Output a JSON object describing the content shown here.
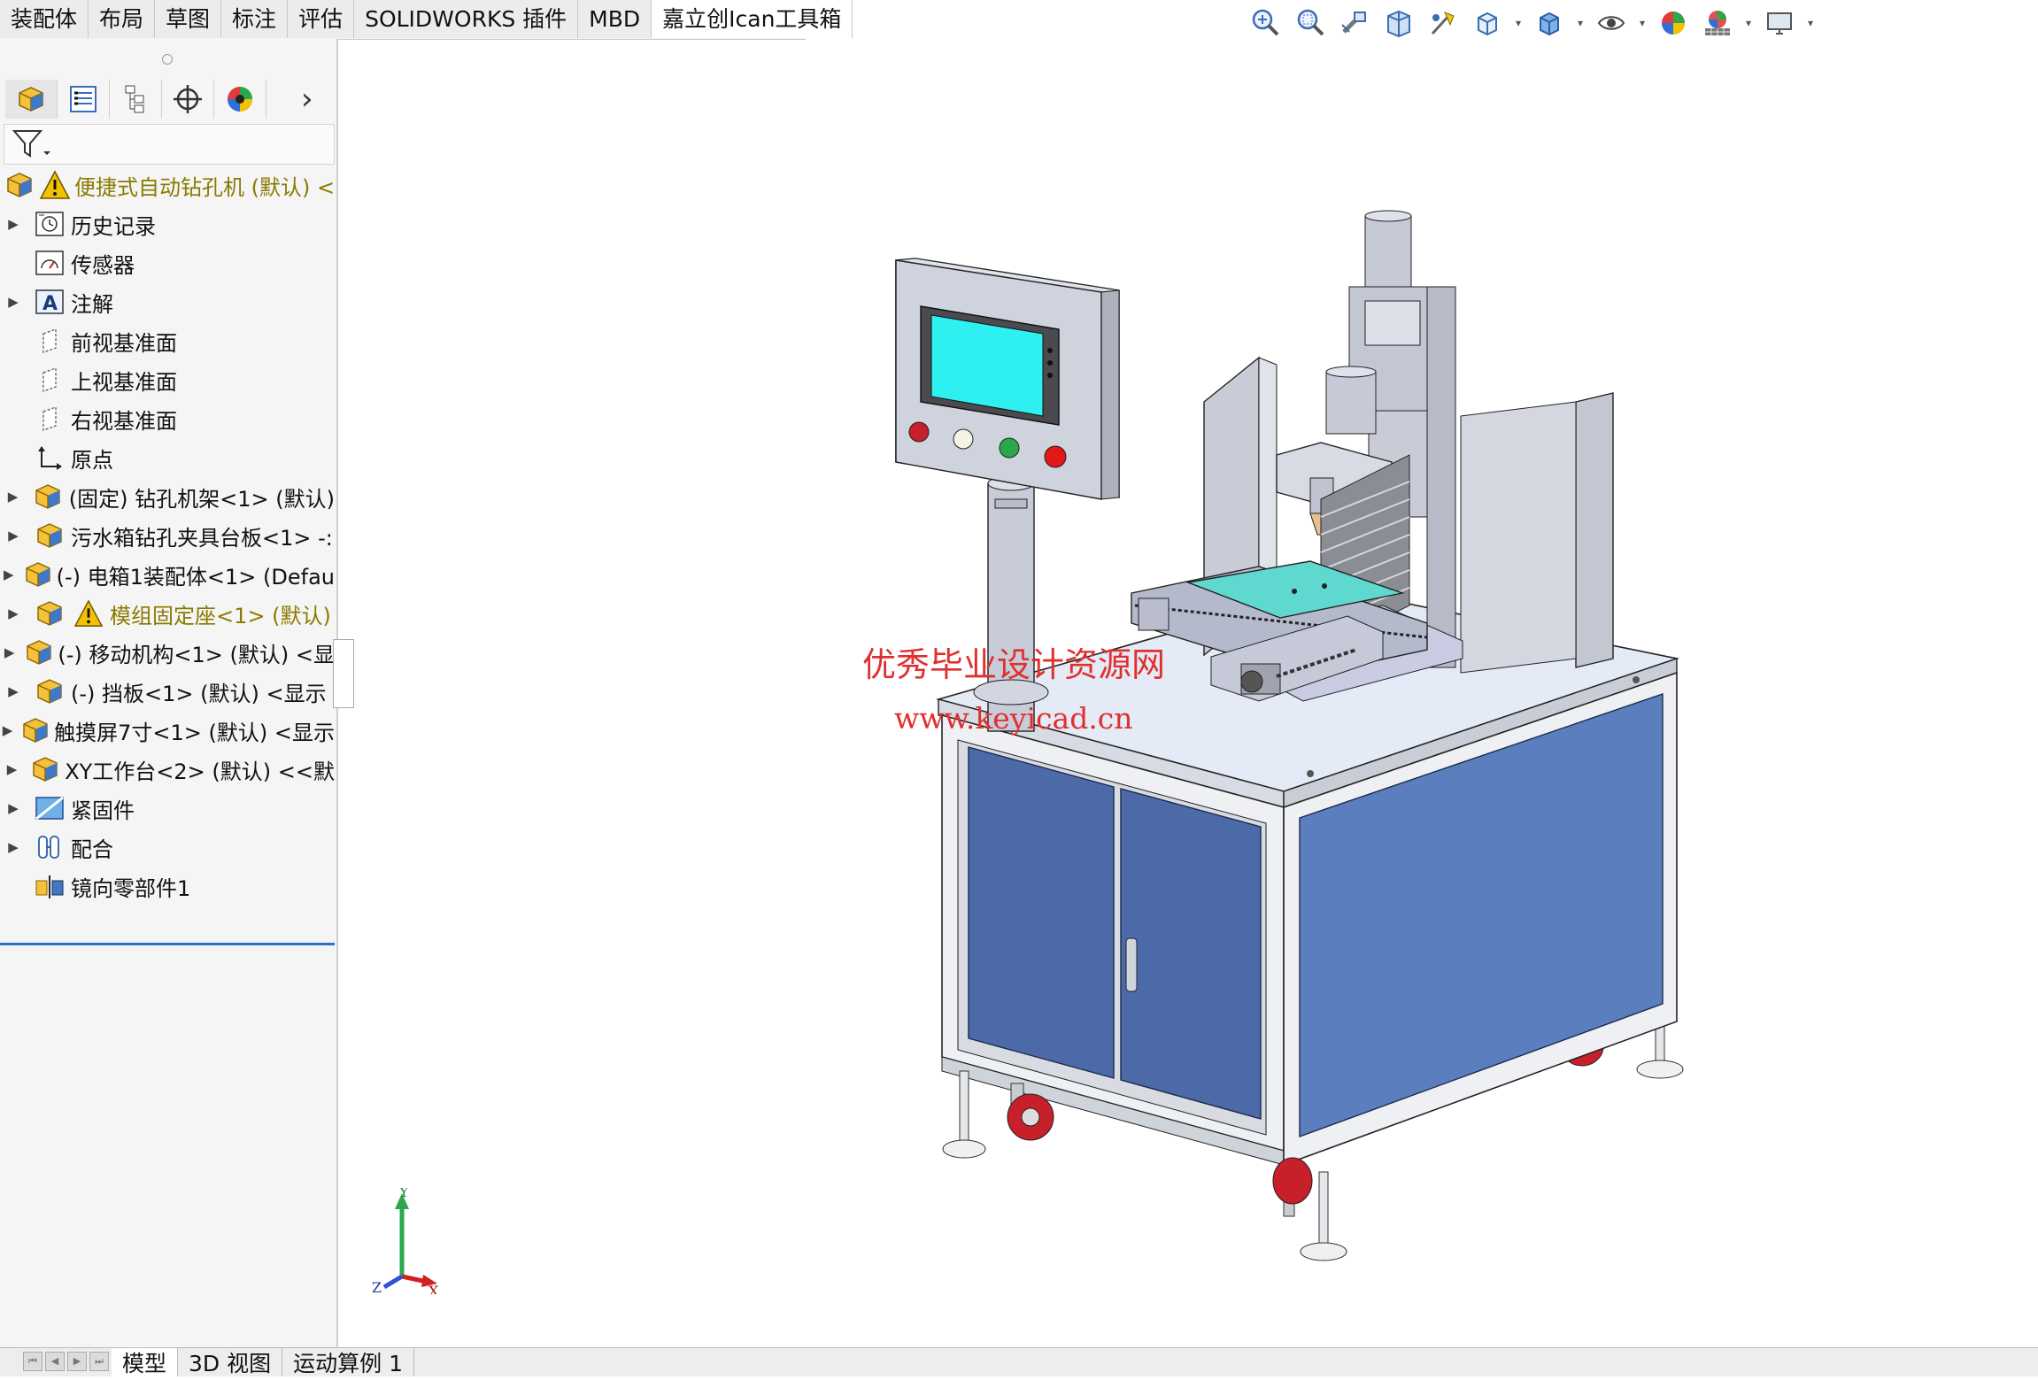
{
  "command_tabs": [
    "装配体",
    "布局",
    "草图",
    "标注",
    "评估",
    "SOLIDWORKS 插件",
    "MBD",
    "嘉立创Ican工具箱"
  ],
  "active_command_tab": 7,
  "view_toolbar": {
    "buttons": [
      "zoom-to-fit-icon",
      "zoom-to-area-icon",
      "previous-view-icon",
      "section-view-icon",
      "dynamic-annotation-icon",
      "view-orientation-icon",
      "display-style-icon",
      "hide-show-icon",
      "edit-appearance-icon",
      "apply-scene-icon",
      "view-setting-icon"
    ]
  },
  "feature_tree": {
    "root": "便捷式自动钻孔机 (默认) <",
    "items": [
      {
        "label": "历史记录",
        "expand": true,
        "icon": "history-icon"
      },
      {
        "label": "传感器",
        "expand": false,
        "icon": "sensor-icon"
      },
      {
        "label": "注解",
        "expand": true,
        "icon": "annotation-icon"
      },
      {
        "label": "前视基准面",
        "expand": false,
        "icon": "plane-icon"
      },
      {
        "label": "上视基准面",
        "expand": false,
        "icon": "plane-icon"
      },
      {
        "label": "右视基准面",
        "expand": false,
        "icon": "plane-icon"
      },
      {
        "label": "原点",
        "expand": false,
        "icon": "origin-icon"
      },
      {
        "label": "(固定) 钻孔机架<1> (默认)",
        "expand": true,
        "icon": "assembly-icon"
      },
      {
        "label": "污水箱钻孔夹具台板<1> -:",
        "expand": true,
        "icon": "assembly-icon"
      },
      {
        "label": "(-) 电箱1装配体<1> (Defau",
        "expand": true,
        "icon": "assembly-icon"
      },
      {
        "label": "模组固定座<1> (默认)",
        "expand": true,
        "icon": "assembly-icon",
        "warning": true
      },
      {
        "label": "(-) 移动机构<1> (默认) <显",
        "expand": true,
        "icon": "assembly-icon"
      },
      {
        "label": "(-) 挡板<1> (默认) <显示",
        "expand": true,
        "icon": "assembly-icon"
      },
      {
        "label": "触摸屏7寸<1> (默认) <显示",
        "expand": true,
        "icon": "assembly-icon"
      },
      {
        "label": "XY工作台<2> (默认) <<默",
        "expand": true,
        "icon": "assembly-icon"
      },
      {
        "label": "紧固件",
        "expand": true,
        "icon": "fastener-folder-icon"
      },
      {
        "label": "配合",
        "expand": true,
        "icon": "mates-icon"
      },
      {
        "label": "镜向零部件1",
        "expand": false,
        "icon": "mirror-component-icon"
      }
    ]
  },
  "bottom_tabs": [
    "模型",
    "3D 视图",
    "运动算例 1"
  ],
  "active_bottom_tab": 0,
  "watermark": {
    "line1": "优秀毕业设计资源网",
    "line2": "www.keyicad.cn"
  },
  "triad": {
    "x": "X",
    "y": "Y",
    "z": "Z"
  },
  "colors": {
    "accent": "#2b73c7",
    "cabinet_blue": "#5b7fbe",
    "screen_cyan": "#2ff0f0",
    "warning_yellow": "#f2c200",
    "watermark_red": "#e0302e"
  }
}
